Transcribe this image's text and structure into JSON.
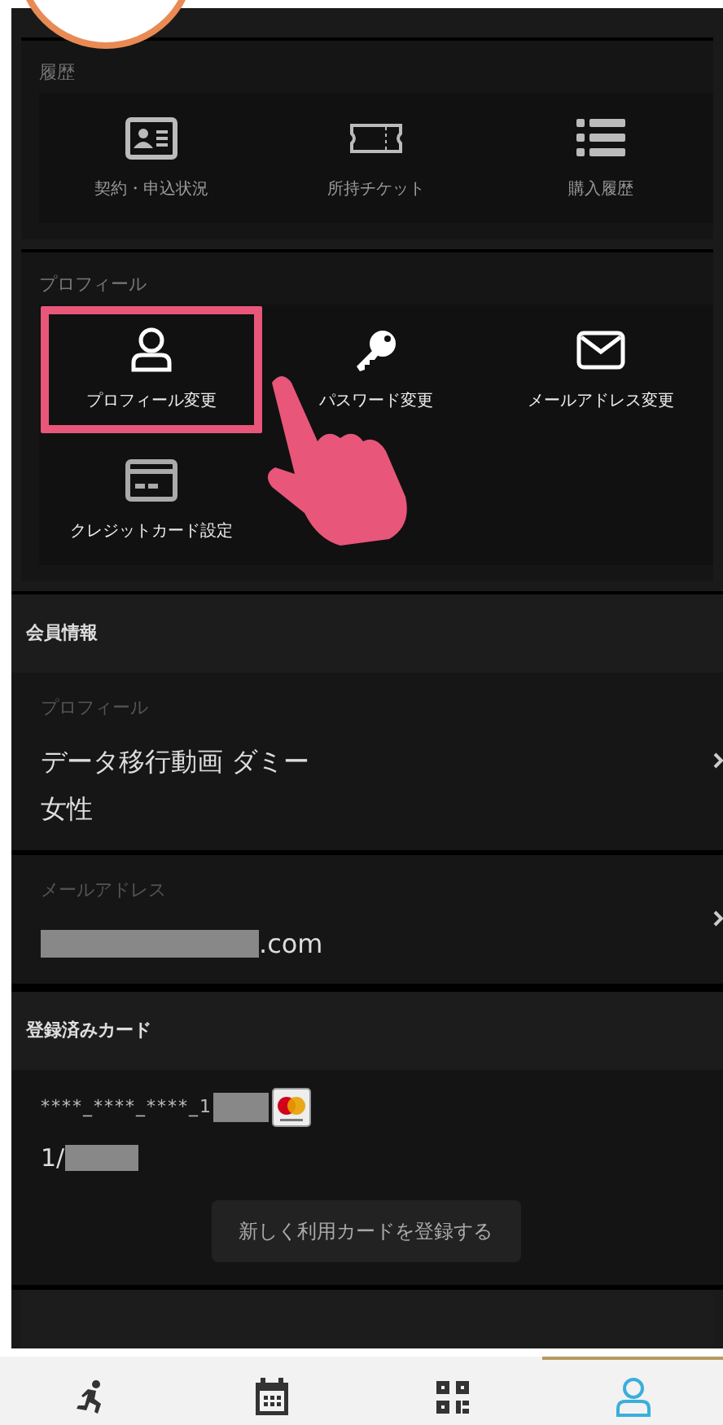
{
  "history": {
    "title": "履歴",
    "items": [
      {
        "label": "契約・申込状況",
        "kind": "id-card",
        "highlighted": false
      },
      {
        "label": "所持チケット",
        "kind": "ticket",
        "highlighted": false
      },
      {
        "label": "購入履歴",
        "kind": "list",
        "highlighted": false
      }
    ]
  },
  "profile_menu": {
    "title": "プロフィール",
    "items": [
      {
        "label": "プロフィール変更",
        "kind": "user",
        "highlighted": true
      },
      {
        "label": "パスワード変更",
        "kind": "key",
        "highlighted": false
      },
      {
        "label": "メールアドレス変更",
        "kind": "mail",
        "highlighted": false
      },
      {
        "label": "クレジットカード設定",
        "kind": "card",
        "highlighted": false
      }
    ]
  },
  "member_info": {
    "title": "会員情報",
    "rows": [
      {
        "label": "プロフィール",
        "values": [
          "データ移行動画 ダミー",
          "女性"
        ],
        "redacted": false
      },
      {
        "label": "メールアドレス",
        "values": [
          ".com"
        ],
        "redacted": true
      }
    ]
  },
  "cards": {
    "title": "登録済みカード",
    "number": "****_****_****_1",
    "expiry": "1/",
    "button": "新しく利用カードを登録する"
  },
  "nav": [
    {
      "kind": "runner",
      "selected": false
    },
    {
      "kind": "calendar",
      "selected": false
    },
    {
      "kind": "qr",
      "selected": false
    },
    {
      "kind": "user",
      "selected": true
    }
  ]
}
